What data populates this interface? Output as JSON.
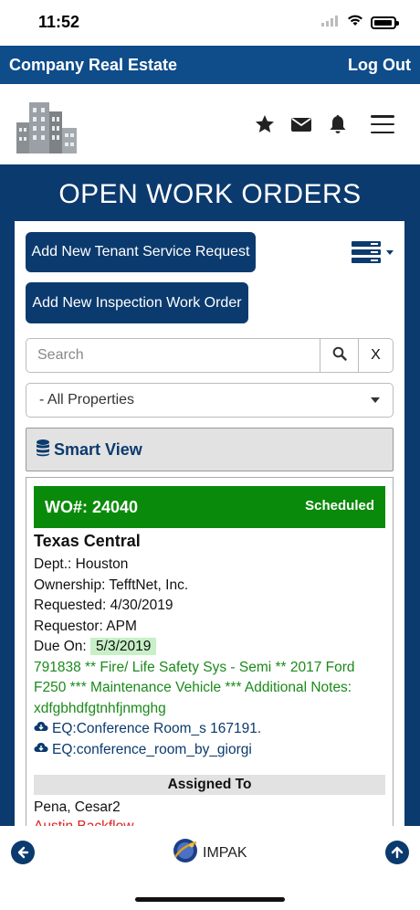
{
  "status_bar": {
    "time": "11:52"
  },
  "topbar": {
    "brand": "Company Real Estate",
    "logout_label": "Log Out"
  },
  "header": {
    "icons": [
      "star-icon",
      "envelope-icon",
      "bell-icon",
      "menu-icon"
    ]
  },
  "page": {
    "title": "OPEN WORK ORDERS"
  },
  "actions": {
    "tenant_request_label": "Add New Tenant Service Request",
    "inspection_label": "Add New Inspection Work Order"
  },
  "search": {
    "placeholder": "Search",
    "value": "",
    "clear_label": "X"
  },
  "filter": {
    "selected": "- All Properties"
  },
  "smart_view": {
    "label": "Smart View"
  },
  "work_order": {
    "number": "WO#: 24040",
    "status": "Scheduled",
    "property": "Texas Central",
    "dept": "Dept.: Houston",
    "ownership": "Ownership: TefftNet, Inc.",
    "requested": "Requested: 4/30/2019",
    "requestor": "Requestor: APM",
    "due_label": "Due On:",
    "due_date": "5/3/2019",
    "description": "791838 ** Fire/ Life Safety Sys - Semi ** 2017 Ford F250 *** Maintenance Vehicle *** Additional Notes: xdfgbhdfgtnhfjnmghg",
    "equipment": [
      "EQ:Conference Room_s 167191.",
      "EQ:conference_room_by_giorgi"
    ],
    "assigned_header": "Assigned To",
    "assigned_name": "Pena, Cesar2",
    "assigned_company": "Austin Backflow"
  },
  "bottom": {
    "brand": "IMPAK"
  },
  "colors": {
    "navy": "#0b3a6e",
    "topbar": "#0e4c8a",
    "scheduled_green": "#0a8a0a",
    "desc_green": "#1a8a1a",
    "alert_red": "#dd2222"
  }
}
